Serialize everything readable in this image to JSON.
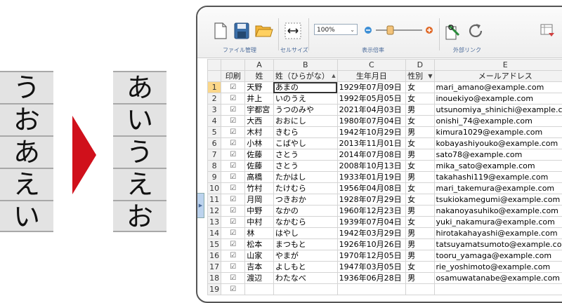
{
  "left_kana": [
    "う",
    "お",
    "あ",
    "え",
    "い"
  ],
  "right_kana": [
    "あ",
    "い",
    "う",
    "え",
    "お"
  ],
  "toolbar": {
    "groups": [
      "ファイル管理",
      "セルサイズ",
      "表示倍率",
      "外部リンク"
    ],
    "zoom_value": "100%",
    "zoom_minus": "−",
    "zoom_plus": "+"
  },
  "grid": {
    "col_letters": [
      "A",
      "B",
      "C",
      "D",
      "E"
    ],
    "headers": [
      "印刷",
      "姓",
      "姓（ひらがな）",
      "生年月日",
      "性別",
      "メールアドレス"
    ],
    "sort_indicator": "▲",
    "filter_indicator": "▼",
    "check_mark": "☑",
    "rows": [
      {
        "n": "1",
        "sei": "天野",
        "kana": "あまの",
        "date": "1929年07月09日",
        "sex": "女",
        "mail": "mari_amano@example.com"
      },
      {
        "n": "2",
        "sei": "井上",
        "kana": "いのうえ",
        "date": "1992年05月05日",
        "sex": "女",
        "mail": "inouekiyo@example.com"
      },
      {
        "n": "3",
        "sei": "宇都宮",
        "kana": "うつのみや",
        "date": "2021年04月03日",
        "sex": "男",
        "mail": "utsunomiya_shinichi@example.com"
      },
      {
        "n": "4",
        "sei": "大西",
        "kana": "おおにし",
        "date": "1980年07月04日",
        "sex": "女",
        "mail": "onishi_74@example.com"
      },
      {
        "n": "5",
        "sei": "木村",
        "kana": "きむら",
        "date": "1942年10月29日",
        "sex": "男",
        "mail": "kimura1029@example.com"
      },
      {
        "n": "6",
        "sei": "小林",
        "kana": "こばやし",
        "date": "2013年11月01日",
        "sex": "女",
        "mail": "kobayashiyouko@example.com"
      },
      {
        "n": "7",
        "sei": "佐藤",
        "kana": "さとう",
        "date": "2014年07月08日",
        "sex": "男",
        "mail": "sato78@example.com"
      },
      {
        "n": "8",
        "sei": "佐藤",
        "kana": "さとう",
        "date": "2008年10月13日",
        "sex": "女",
        "mail": "mika_sato@example.com"
      },
      {
        "n": "9",
        "sei": "高橋",
        "kana": "たかはし",
        "date": "1933年01月19日",
        "sex": "男",
        "mail": "takahashi119@example.com"
      },
      {
        "n": "10",
        "sei": "竹村",
        "kana": "たけむら",
        "date": "1956年04月08日",
        "sex": "女",
        "mail": "mari_takemura@example.com"
      },
      {
        "n": "11",
        "sei": "月岡",
        "kana": "つきおか",
        "date": "1928年07月29日",
        "sex": "女",
        "mail": "tsukiokamegumi@example.com"
      },
      {
        "n": "12",
        "sei": "中野",
        "kana": "なかの",
        "date": "1960年12月23日",
        "sex": "男",
        "mail": "nakanoyasuhiko@example.com"
      },
      {
        "n": "13",
        "sei": "中村",
        "kana": "なかむら",
        "date": "1939年07月04日",
        "sex": "女",
        "mail": "yuki_nakamura@example.com"
      },
      {
        "n": "14",
        "sei": "林",
        "kana": "はやし",
        "date": "1942年03月29日",
        "sex": "男",
        "mail": "hirotakahayashi@example.com"
      },
      {
        "n": "15",
        "sei": "松本",
        "kana": "まつもと",
        "date": "1926年10月26日",
        "sex": "男",
        "mail": "tatsuyamatsumoto@example.com"
      },
      {
        "n": "16",
        "sei": "山家",
        "kana": "やまが",
        "date": "1970年12月05日",
        "sex": "男",
        "mail": "tooru_yamaga@example.com"
      },
      {
        "n": "17",
        "sei": "吉本",
        "kana": "よしもと",
        "date": "1947年03月05日",
        "sex": "女",
        "mail": "rie_yoshimoto@example.com"
      },
      {
        "n": "18",
        "sei": "渡辺",
        "kana": "わたなべ",
        "date": "1936年06月28日",
        "sex": "男",
        "mail": "osamuwatanabe@example.com"
      },
      {
        "n": "19",
        "sei": "",
        "kana": "",
        "date": "",
        "sex": "",
        "mail": ""
      }
    ]
  },
  "colors": {
    "arrow": "#d0101b",
    "selected_column": "#fbd78a",
    "cell_bg": "#e3e3e3"
  }
}
